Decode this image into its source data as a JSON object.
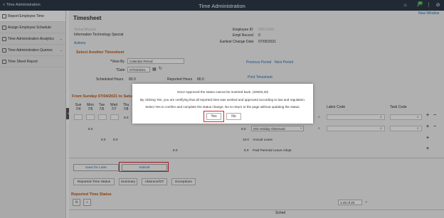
{
  "topbar": {
    "back_label": "< Time Administration",
    "title": "Time Administration",
    "notification_count": "19"
  },
  "nav": {
    "items": [
      {
        "label": "Report Employee Time"
      },
      {
        "label": "Assign Employee Schedule"
      },
      {
        "label": "Time Administration Analytics"
      },
      {
        "label": "Time Administration Queries"
      },
      {
        "label": "Time Sheet Report"
      }
    ]
  },
  "page": {
    "title": "Timesheet",
    "new_window": "New Window",
    "employee_name": "Vishal Bhaarti",
    "department": "Information Technology Special",
    "actions": "Actions",
    "employee_id_label": "Employee ID",
    "employee_id_value": "00012345",
    "empl_record_label": "Empl Record",
    "empl_record_value": "0",
    "earliest_change_label": "Earliest Change Date",
    "earliest_change_value": "07/05/2021",
    "select_section": "Select Another Timesheet",
    "view_by_label": "*View By",
    "view_by_value": "Calendar Period",
    "date_label": "*Date",
    "date_value": "07/04/2021",
    "previous_period": "Previous Period",
    "next_period": "Next Period",
    "scheduled_hours_label": "Scheduled Hours",
    "scheduled_hours_value": "80.0",
    "reported_hours_label": "Reported Hours",
    "reported_hours_value": "80.0",
    "print_timesheet": "Print Timesheet",
    "period_heading": "From Sunday 07/04/2021 to Saturday 07/17/2021",
    "day_headers": [
      {
        "d": "Sun",
        "n": "7/4"
      },
      {
        "d": "Mon",
        "n": "7/5"
      },
      {
        "d": "Tue",
        "n": "7/6"
      },
      {
        "d": "Wed",
        "n": "7/7"
      },
      {
        "d": "Thu",
        "n": "7/8"
      }
    ],
    "labor_code_label": "Labor Code",
    "task_code_label": "Task Code",
    "rows": [
      {
        "c4": "9.0",
        "total": "",
        "trc": ""
      },
      {
        "c1": "8.0",
        "total": "8.0",
        "trc": "003 Holiday Observed"
      },
      {
        "c2": "8.0",
        "c3": "8.0",
        "total": "16.0",
        "trc": "Annual Leave"
      },
      {
        "c8": "8.0",
        "total": "8.0",
        "trc": "Paid Parental Leave Adopt"
      }
    ],
    "save_for_later": "Save for Later",
    "submit": "Submit",
    "tabs": [
      "Reported Time Status",
      "Summary",
      "Absence/OT",
      "Exceptions"
    ],
    "reported_status_heading": "Reported Time Status",
    "pagination": "1-20 of 20",
    "sched_col": "Sched"
  },
  "modal": {
    "line1": "Once Approved the status cannot be reverted back. (20020,20)",
    "line2": "By clicking Yes, you are certifying that all reported time was worked and approved according to law and regulation.",
    "line3": "Select Yes to confirm and complete the status change. No to return to the page without updating the status.",
    "yes": "Yes",
    "no": "No"
  },
  "colors": {
    "topbar": "#2f3b48",
    "accent_link": "#2a74b8",
    "section_heading": "#c05b12",
    "highlight_box": "#d8262b"
  }
}
